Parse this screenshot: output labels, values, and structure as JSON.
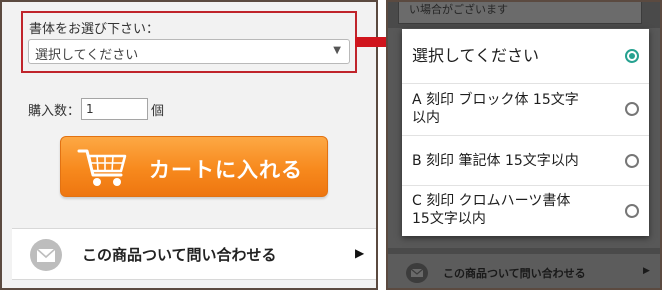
{
  "left": {
    "font_select": {
      "label": "書体をお選び下さい：",
      "value": "選択してください",
      "arrow": "▼"
    },
    "quantity": {
      "label": "購入数：",
      "value": "1",
      "unit": "個"
    },
    "cart_button": {
      "label": "カートに入れる"
    },
    "inquiry": {
      "label": "この商品ついて問い合わせる",
      "arrow": "▶"
    }
  },
  "right": {
    "background_top_text": "い場合がございます",
    "dropdown": {
      "options": [
        {
          "line1": "選択してください",
          "line2": "",
          "selected": true
        },
        {
          "line1": "A 刻印 ブロック体 15文字",
          "line2": "以内",
          "selected": false
        },
        {
          "line1": "B 刻印 筆記体 15文字以内",
          "line2": "",
          "selected": false
        },
        {
          "line1": "C 刻印 クロムハーツ書体",
          "line2": "15文字以内",
          "selected": false
        }
      ]
    },
    "background_inquiry": {
      "label": "この商品ついて問い合わせる",
      "arrow": "▶"
    }
  },
  "colors": {
    "highlight_border": "#c0242b",
    "cart_orange": "#f7891d",
    "radio_selected": "#26a190",
    "panel_border": "#5b4a40"
  }
}
